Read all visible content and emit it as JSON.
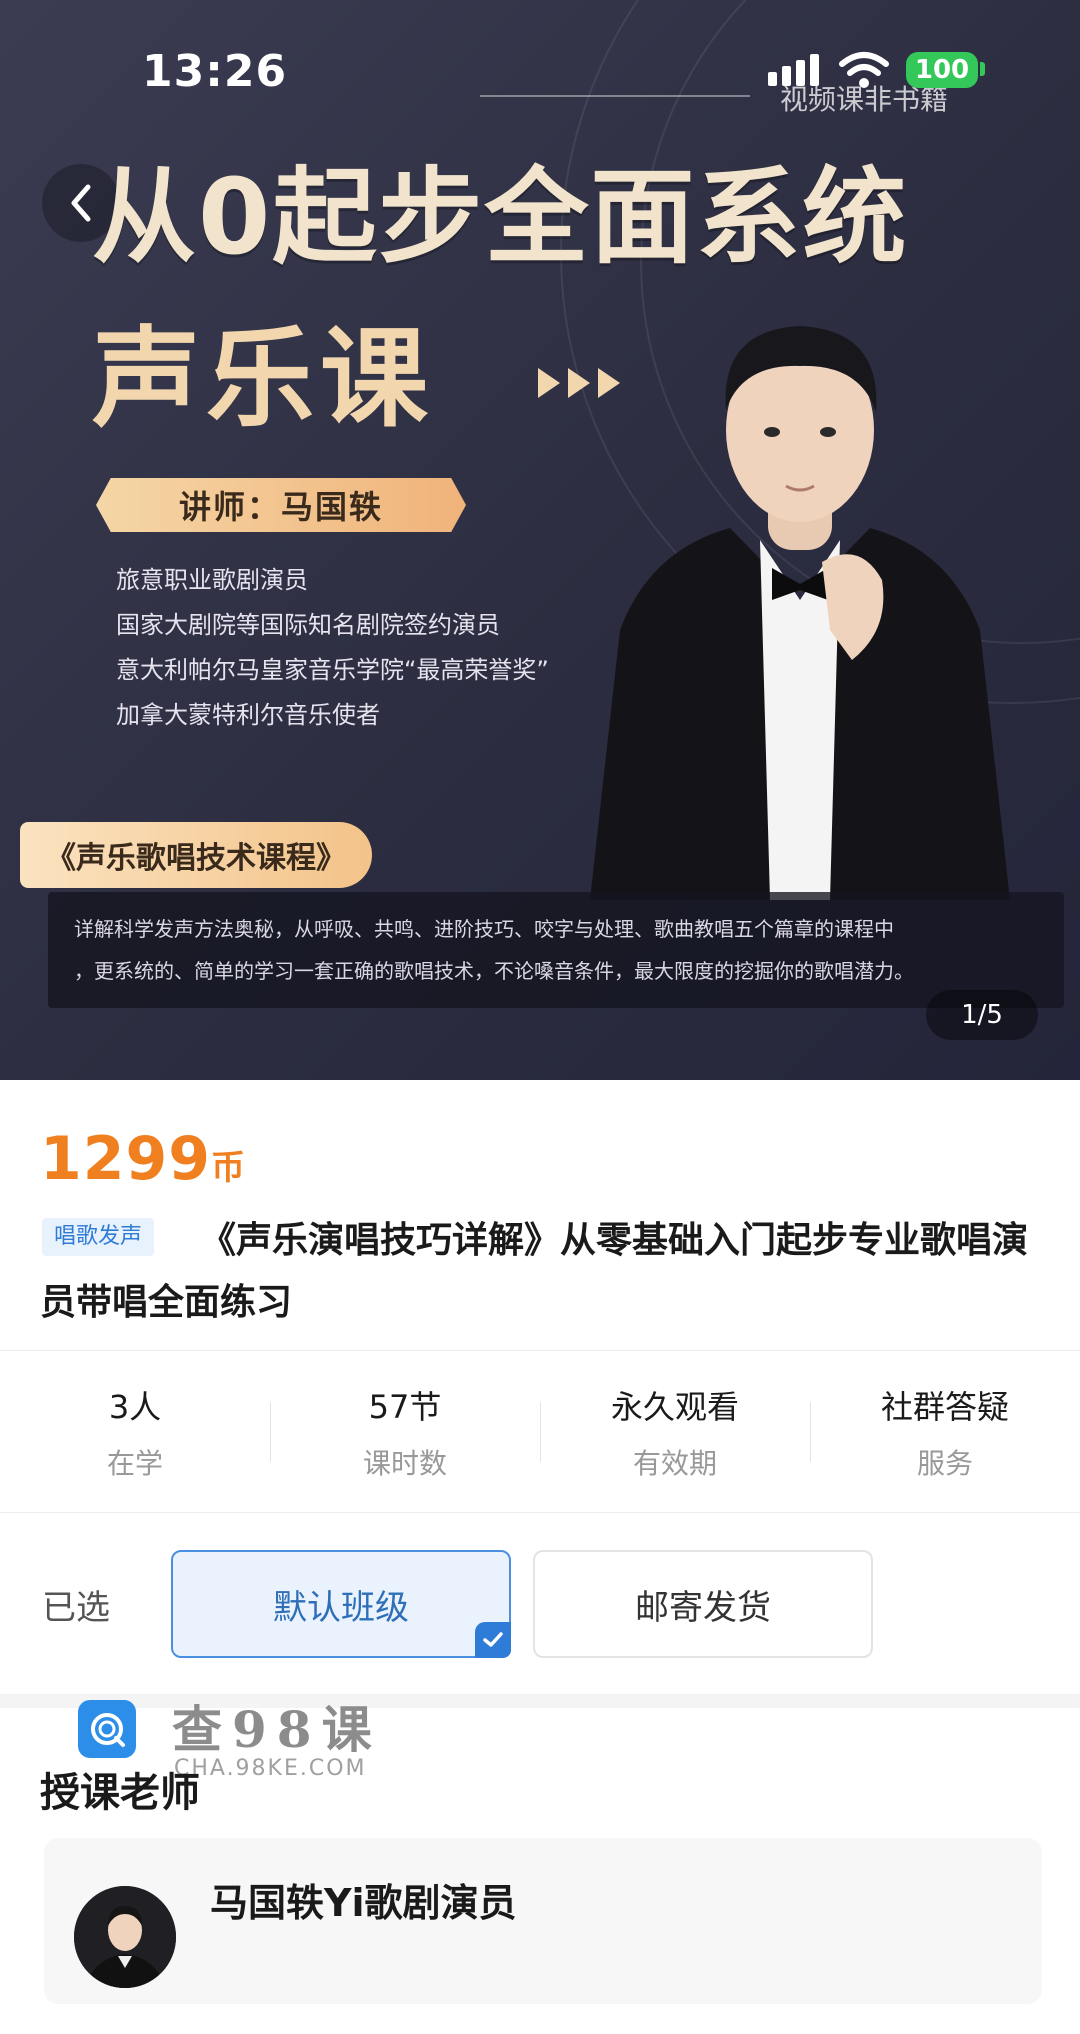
{
  "status_bar": {
    "time": "13:26",
    "battery": "100",
    "overlay_tag": "视频课非书籍"
  },
  "banner": {
    "headline": "从0起步全面系统",
    "headline2": "声乐课",
    "teacher_tag": "讲师：马国轶",
    "credentials": [
      "旅意职业歌剧演员",
      "国家大剧院等国际知名剧院签约演员",
      "意大利帕尔马皇家音乐学院“最高荣誉奖”",
      "加拿大蒙特利尔音乐使者"
    ],
    "course_tag": "《声乐歌唱技术课程》",
    "description": [
      "详解科学发声方法奥秘，从呼吸、共鸣、进阶技巧、咬字与处理、歌曲教唱五个篇章的课程中",
      "，更系统的、简单的学习一套正确的歌唱技术，不论嗓音条件，最大限度的挖掘你的歌唱潜力。"
    ],
    "page_indicator": "1/5"
  },
  "product": {
    "price": "1299",
    "price_unit": "币",
    "category": "唱歌发声",
    "title": "《声乐演唱技巧详解》从零基础入门起步专业歌唱演员带唱全面练习"
  },
  "stats": [
    {
      "value": "3人",
      "label": "在学"
    },
    {
      "value": "57节",
      "label": "课时数"
    },
    {
      "value": "永久观看",
      "label": "有效期"
    },
    {
      "value": "社群答疑",
      "label": "服务"
    }
  ],
  "selection": {
    "label": "已选",
    "options": [
      "默认班级",
      "邮寄发货"
    ],
    "selected_index": 0
  },
  "watermark": {
    "text": "查98课",
    "url": "CHA.98KE.COM"
  },
  "teacher_section": {
    "title": "授课老师",
    "teacher_name": "马国轶Yi歌剧演员"
  },
  "colors": {
    "price": "#f07f20",
    "accent": "#2f7bd8",
    "banner_bg": "#2c2d40",
    "gold": "#f2d7ae"
  }
}
